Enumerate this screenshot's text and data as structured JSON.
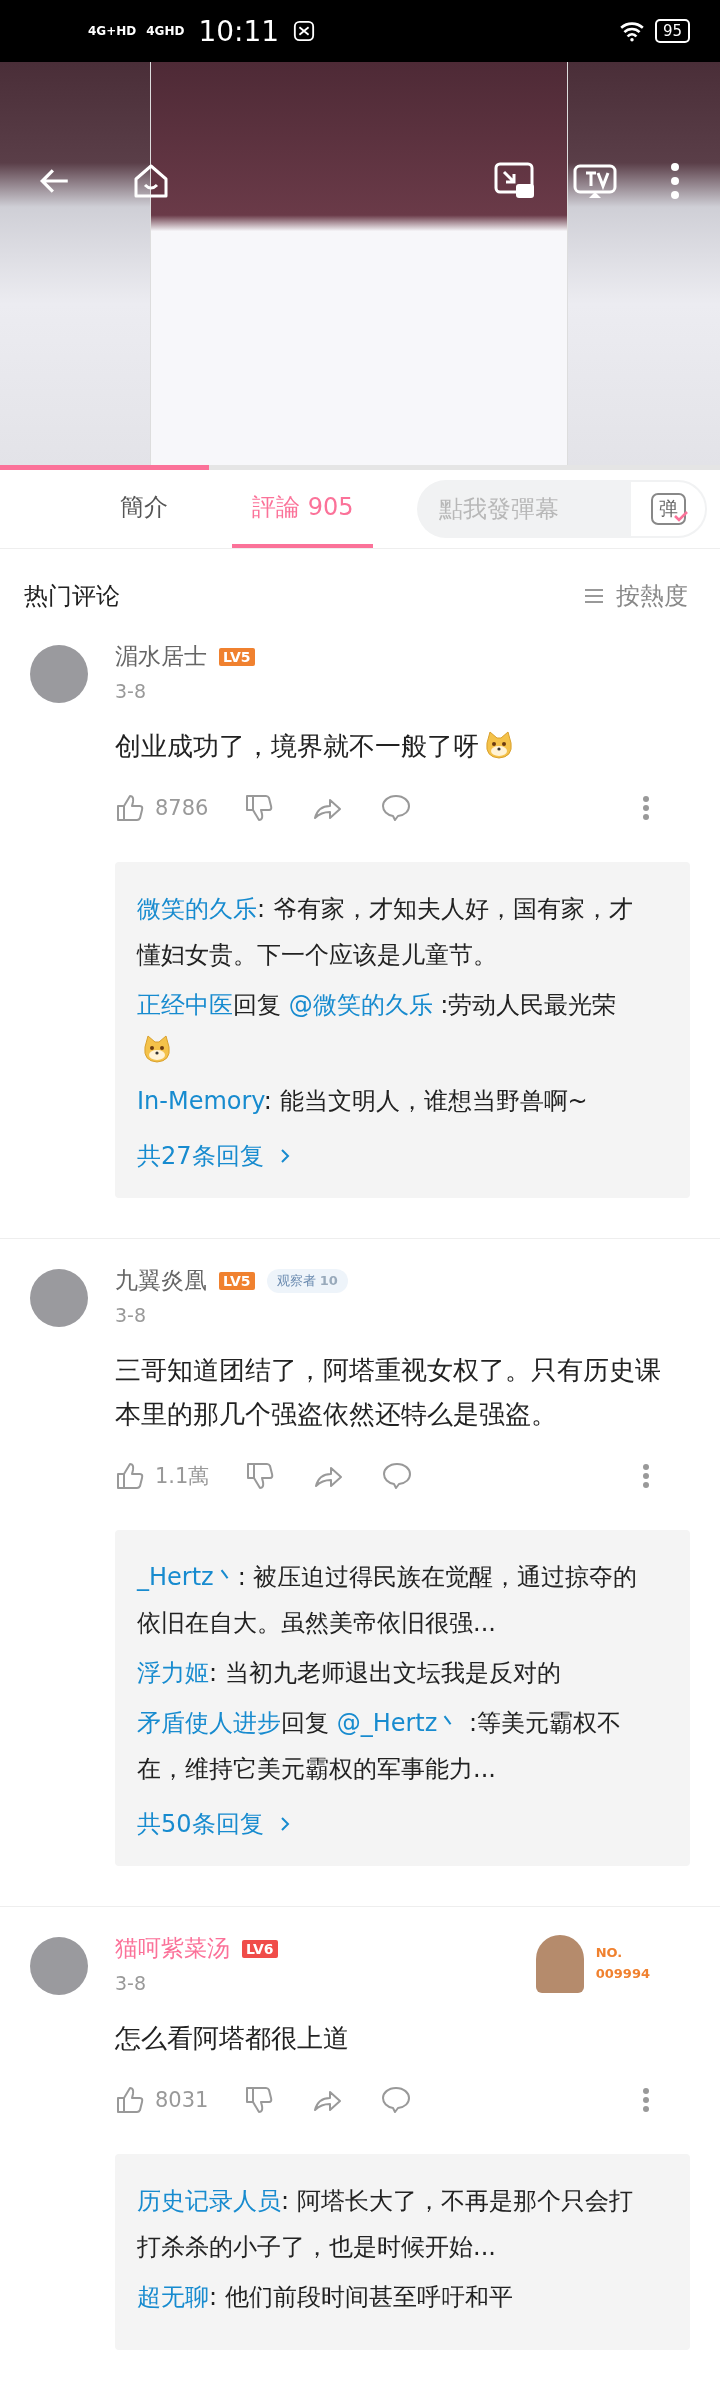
{
  "status_bar": {
    "networks": [
      "4G+HD",
      "4GHD"
    ],
    "time": "10:11",
    "battery": "95"
  },
  "video": {
    "progress": {
      "level": 0.29
    }
  },
  "tabs": [
    {
      "label": "簡介",
      "selected": false
    },
    {
      "label": "評論 905",
      "selected": true
    }
  ],
  "danmaku_input": {
    "placeholder": "點我發彈幕",
    "toggle_label": "弹"
  },
  "section": {
    "title": "热门评论",
    "sort": "按熱度"
  },
  "comments": [
    {
      "user": "湄水居士",
      "vip": false,
      "level": {
        "label": "LV5",
        "color": "#f0812f"
      },
      "date": "3-8",
      "text": "创业成功了，境界就不一般了呀",
      "emoji": true,
      "likes": "8786",
      "replies": [
        {
          "author": "微笑的久乐",
          "text": ": 爷有家，才知夫人好，国有家，才懂妇女贵。下一个应该是儿童节。",
          "emoji": false
        },
        {
          "author": "正经中医",
          "reply_word": "回复",
          "reply_to": "@微笑的久乐",
          "text": " :劳动人民最光荣",
          "emoji": true
        },
        {
          "author": "In-Memory",
          "text": ": 能当文明人，谁想当野兽啊~",
          "emoji": false
        }
      ],
      "reply_total": "共27条回复"
    },
    {
      "user": "九翼炎凰",
      "vip": false,
      "level": {
        "label": "LV5",
        "color": "#f0812f"
      },
      "badge": {
        "label": "观察者",
        "count": "10"
      },
      "date": "3-8",
      "text": "三哥知道团结了，阿塔重视女权了。只有历史课本里的那几个强盗依然还特么是强盗。",
      "emoji": false,
      "likes": "1.1萬",
      "replies": [
        {
          "author": "_Hertz丶",
          "text": ": 被压迫过得民族在觉醒，通过掠夺的依旧在自大。虽然美帝依旧很强...",
          "emoji": false
        },
        {
          "author": "浮力姬",
          "text": ": 当初九老师退出文坛我是反对的",
          "emoji": false
        },
        {
          "author": "矛盾使人进步",
          "reply_word": "回复",
          "reply_to": "@_Hertz丶",
          "text": " :等美元霸权不在，维持它美元霸权的军事能力...",
          "emoji": false
        }
      ],
      "reply_total": "共50条回复"
    },
    {
      "user": "猫呵紫菜汤",
      "vip": true,
      "level": {
        "label": "LV6",
        "color": "#f04c49"
      },
      "fan_card": {
        "label": "NO.",
        "number": "009994"
      },
      "date": "3-8",
      "text": "怎么看阿塔都很上道",
      "emoji": false,
      "likes": "8031",
      "replies": [
        {
          "author": "历史记录人员",
          "text": ": 阿塔长大了，不再是那个只会打打杀杀的小子了，也是时候开始...",
          "emoji": false
        },
        {
          "author": "超无聊",
          "text": ": 他们前段时间甚至呼吁和平",
          "emoji": false
        }
      ]
    }
  ]
}
